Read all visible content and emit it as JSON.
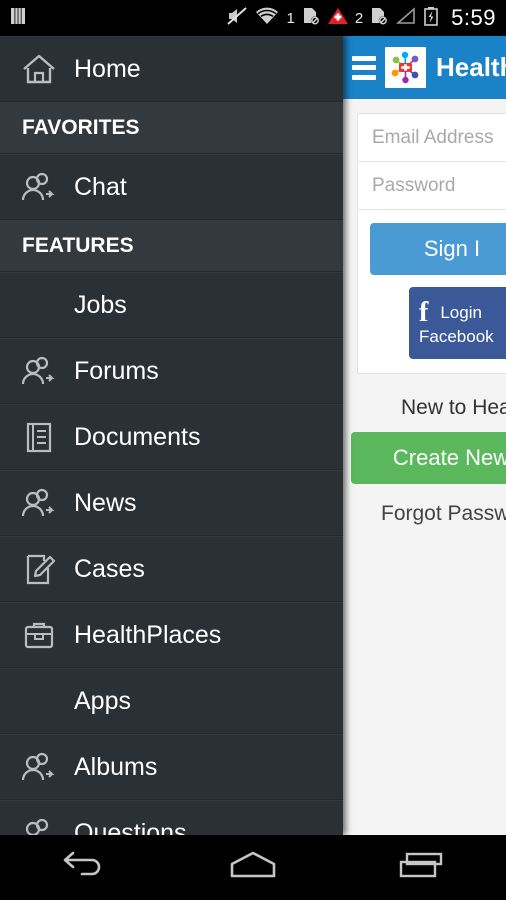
{
  "status_bar": {
    "left_icon": "sim-card-icon",
    "icons": [
      "mute-icon",
      "wifi-icon",
      "sd-card-removed-icon",
      "alert-triangle-icon",
      "sd-card-removed-icon",
      "signal-icon",
      "battery-charging-icon"
    ],
    "badge_1": "1",
    "badge_2": "2",
    "clock": "5:59"
  },
  "app_bar": {
    "menu_icon": "hamburger-icon",
    "logo_icon": "healthnetwork-logo-icon",
    "title": "Health"
  },
  "login": {
    "email_placeholder": "Email Address",
    "password_placeholder": "Password",
    "email_value": "",
    "password_value": "",
    "sign_in_label": "Sign I",
    "facebook_icon": "facebook-f-icon",
    "facebook_login_label": "Login",
    "facebook_label": "Facebook",
    "new_to_label": "New to Hea",
    "create_account_label": "Create New",
    "forgot_password_label": "Forgot Passwo"
  },
  "drawer": {
    "rows": [
      {
        "type": "item",
        "label": "Home",
        "icon": "home-icon"
      },
      {
        "type": "section",
        "label": "FAVORITES",
        "icon": ""
      },
      {
        "type": "item",
        "label": "Chat",
        "icon": "people-icon"
      },
      {
        "type": "section",
        "label": "FEATURES",
        "icon": ""
      },
      {
        "type": "noicon",
        "label": "Jobs",
        "icon": ""
      },
      {
        "type": "item",
        "label": "Forums",
        "icon": "people-icon"
      },
      {
        "type": "item",
        "label": "Documents",
        "icon": "document-icon"
      },
      {
        "type": "item",
        "label": "News",
        "icon": "people-icon"
      },
      {
        "type": "item",
        "label": "Cases",
        "icon": "edit-note-icon"
      },
      {
        "type": "item",
        "label": "HealthPlaces",
        "icon": "briefcase-icon"
      },
      {
        "type": "noicon",
        "label": "Apps",
        "icon": ""
      },
      {
        "type": "item",
        "label": "Albums",
        "icon": "people-icon"
      },
      {
        "type": "item",
        "label": "Questions",
        "icon": "people-icon"
      }
    ]
  },
  "nav_bar": {
    "back_icon": "back-arrow-icon",
    "home_icon": "home-outline-icon",
    "recents_icon": "recent-apps-icon"
  },
  "colors": {
    "app_bar_blue": "#1a82c7",
    "sign_in_blue": "#4a9ad4",
    "facebook_blue": "#3b5998",
    "create_green": "#5cb85c",
    "drawer_bg": "#2b3034",
    "drawer_section_bg": "#34393e"
  }
}
